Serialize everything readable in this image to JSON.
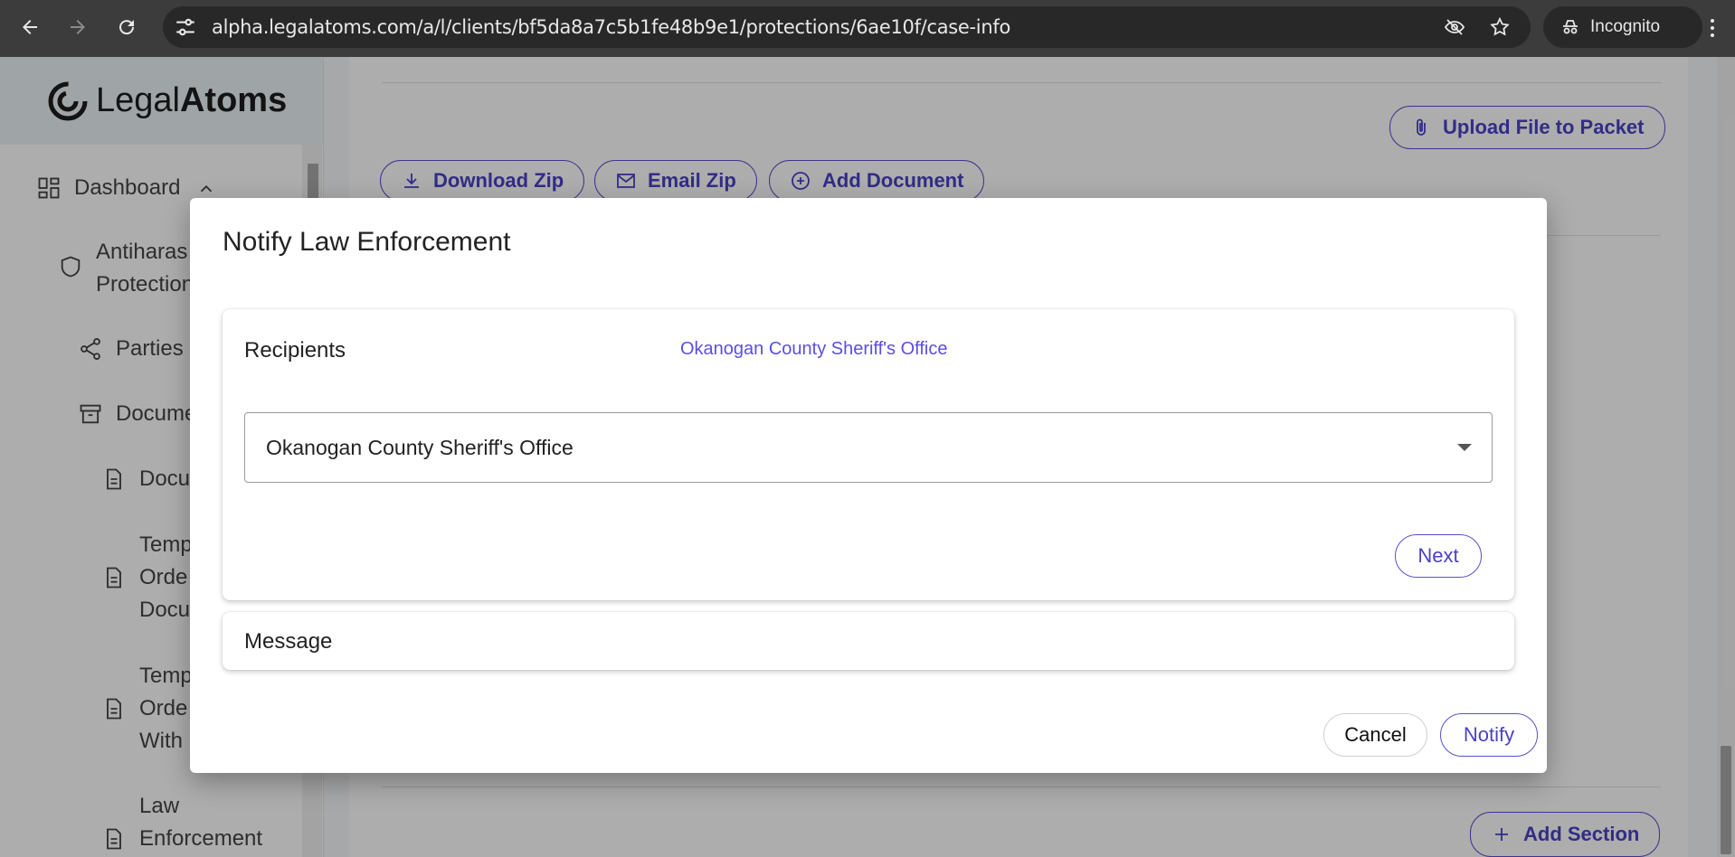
{
  "browser": {
    "url": "alpha.legalatoms.com/a/l/clients/bf5da8a7c5b1fe48b9e1/protections/6ae10f/case-info",
    "incognito_label": "Incognito"
  },
  "sidebar": {
    "logo_light": "Legal",
    "logo_bold": "Atoms",
    "items": [
      {
        "label": "Dashboard"
      },
      {
        "label": "Antiharas\nProtection"
      },
      {
        "label": "Parties"
      },
      {
        "label": "Docume"
      },
      {
        "label": "Docu"
      },
      {
        "label": "Temp\nOrde\nDocu"
      },
      {
        "label": "Temp\nOrde\nWith"
      },
      {
        "label": "Law\nEnforcement"
      }
    ]
  },
  "main": {
    "upload_label": "Upload File to Packet",
    "download_zip_label": "Download Zip",
    "email_zip_label": "Email Zip",
    "add_document_label": "Add Document",
    "add_section_label": "Add Section"
  },
  "dialog": {
    "title": "Notify Law Enforcement",
    "recipients": {
      "label": "Recipients",
      "summary": "Okanogan County Sheriff's Office",
      "selected": "Okanogan County Sheriff's Office",
      "next_label": "Next"
    },
    "message": {
      "label": "Message"
    },
    "cancel_label": "Cancel",
    "notify_label": "Notify"
  }
}
